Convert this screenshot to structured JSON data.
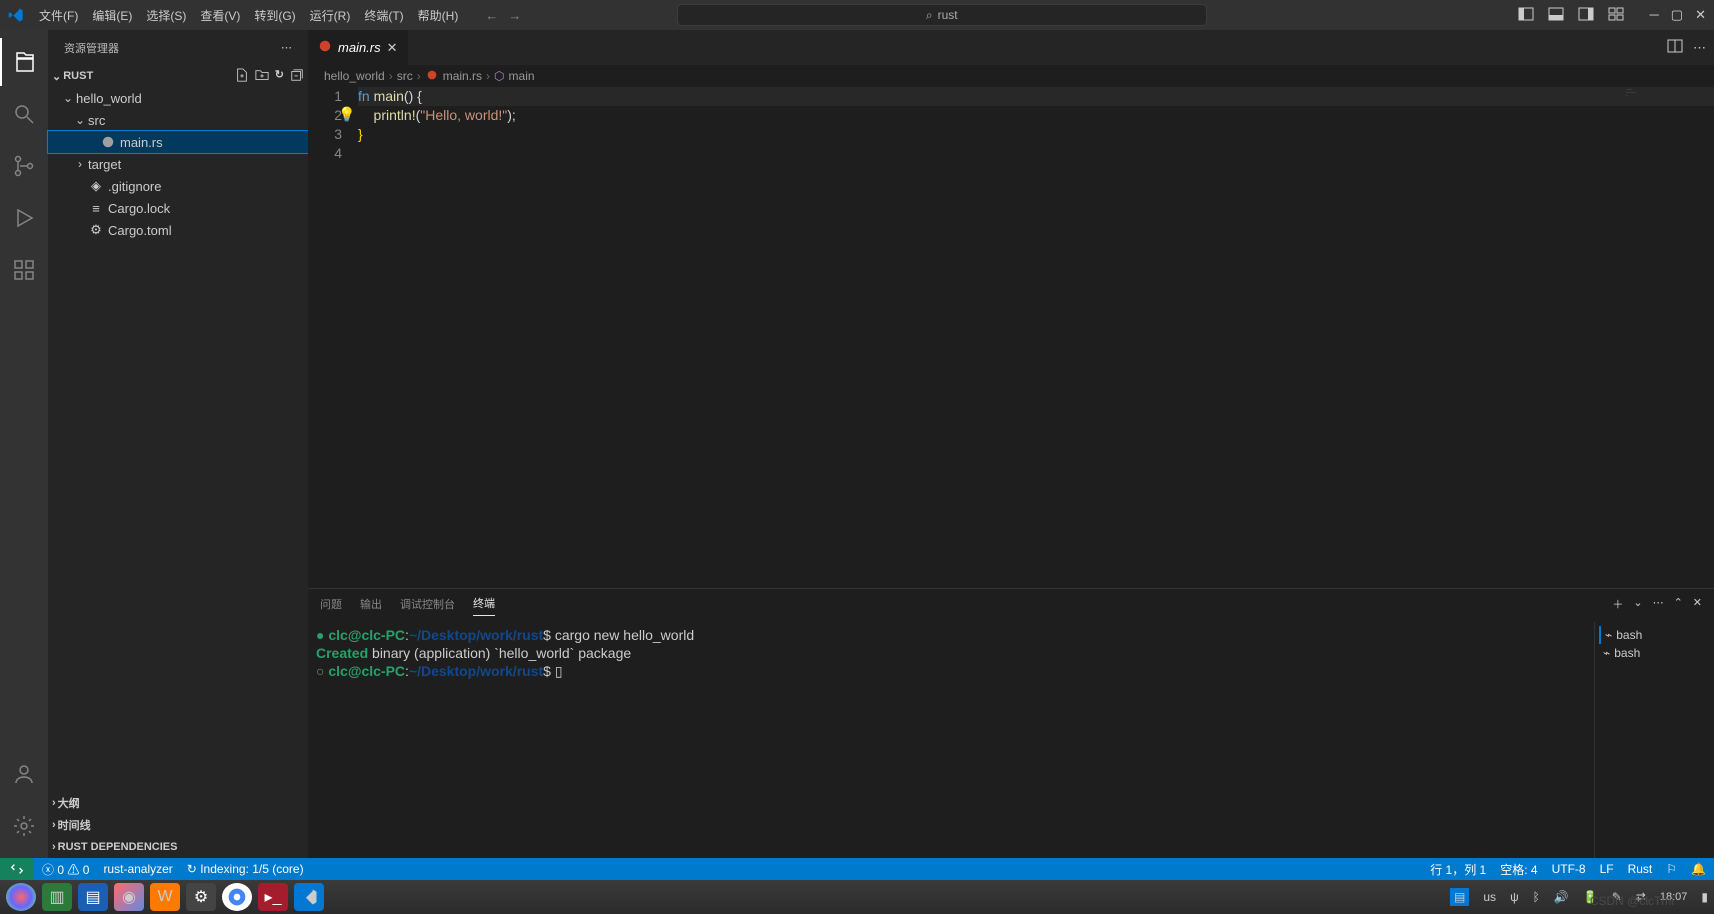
{
  "menu": [
    "文件(F)",
    "编辑(E)",
    "选择(S)",
    "查看(V)",
    "转到(G)",
    "运行(R)",
    "终端(T)",
    "帮助(H)"
  ],
  "search": {
    "text": "rust"
  },
  "sidebar": {
    "title": "资源管理器",
    "root": "RUST",
    "tree": {
      "folder1": "hello_world",
      "folder2": "src",
      "file_main": "main.rs",
      "folder_target": "target",
      "file_gitignore": ".gitignore",
      "file_cargolock": "Cargo.lock",
      "file_cargotoml": "Cargo.toml"
    },
    "outline": "大纲",
    "timeline": "时间线",
    "rustdeps": "RUST DEPENDENCIES"
  },
  "tabs": {
    "main": "main.rs"
  },
  "breadcrumb": [
    "hello_world",
    "src",
    "main.rs",
    "main"
  ],
  "code": {
    "l1_kw": "fn",
    "l1_fn": " main",
    "l1_rest": "() {",
    "l2_mac": "    println!",
    "l2_open": "(",
    "l2_str": "\"Hello, world!\"",
    "l2_close": ");",
    "l3": "}"
  },
  "linenums": [
    "1",
    "2",
    "3",
    "4"
  ],
  "panel": {
    "tabs": {
      "problems": "问题",
      "output": "输出",
      "debug": "调试控制台",
      "terminal": "终端"
    },
    "term_user": "clc@clc-PC",
    "term_path": "~/Desktop/work/rust",
    "cmd1": "cargo new hello_world",
    "out1_prefix": "     Created",
    "out1_rest": " binary (application) `hello_world` package",
    "shells": [
      "bash",
      "bash"
    ]
  },
  "status": {
    "errors": "0",
    "warnings": "0",
    "analyzer": "rust-analyzer",
    "indexing": "Indexing: 1/5 (core)",
    "pos": "行 1，列 1",
    "spaces": "空格: 4",
    "encoding": "UTF-8",
    "eol": "LF",
    "lang": "Rust"
  },
  "taskbar": {
    "lang": "us",
    "time": "18:07"
  },
  "watermark": "CSDN @clcTmi"
}
